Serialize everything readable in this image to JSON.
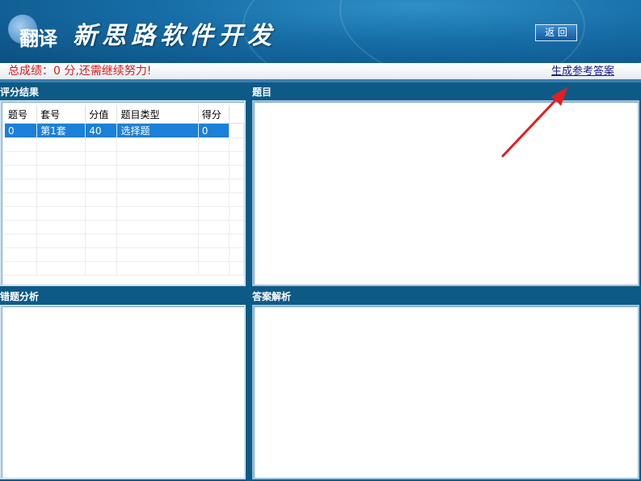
{
  "header": {
    "logo_text": "翻译",
    "title": "新思路软件开发",
    "back_button": "返 回"
  },
  "score": {
    "text": "总成绩：0 分,还需继续努力!",
    "generate_answer_link": "生成参考答案"
  },
  "sections": {
    "scoring_results": "评分结果",
    "question": "题目",
    "error_analysis": "错题分析",
    "answer_explanation": "答案解析"
  },
  "results_table": {
    "columns": [
      "题号",
      "套号",
      "分值",
      "题目类型",
      "得分"
    ],
    "rows": [
      [
        "0",
        "第1套",
        "40",
        "选择题",
        "0"
      ]
    ]
  },
  "colors": {
    "header_blue": "#166da6",
    "score_red": "#d41a1a",
    "selection_blue": "#1c7fd8",
    "arrow_red": "#e02020"
  }
}
